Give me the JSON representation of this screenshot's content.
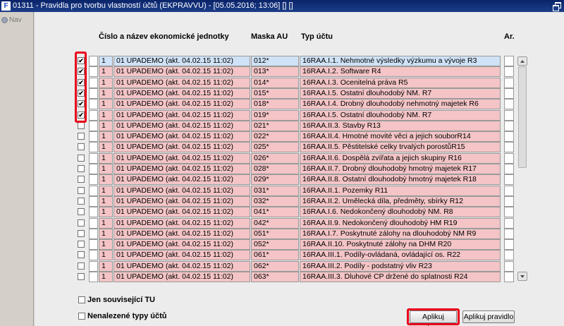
{
  "window": {
    "title": "01311 - Pravidla pro tvorbu vlastností účtů (EKPRAVVU) - [05.05.2016; 13:06] [] []",
    "app_icon": "F"
  },
  "nav": {
    "label": "Nav"
  },
  "columns": {
    "unit": "Číslo a název ekonomické jednotky",
    "mask": "Maska AU",
    "type": "Typ účtu",
    "ar": "Ar."
  },
  "rows": [
    {
      "checked": true,
      "num": "1",
      "unit": "01 UPADEMO (akt. 04.02.15 11:02)",
      "mask": "012*",
      "type": "16RAA.I.1.  Nehmotné výsledky výzkumu a vývoje R3",
      "highlight": "blue"
    },
    {
      "checked": true,
      "num": "1",
      "unit": "01 UPADEMO (akt. 04.02.15 11:02)",
      "mask": "013*",
      "type": "16RAA.I.2.  Software R4",
      "highlight": "pink"
    },
    {
      "checked": true,
      "num": "1",
      "unit": "01 UPADEMO (akt. 04.02.15 11:02)",
      "mask": "014*",
      "type": "16RAA.I.3.  Ocenitelná práva R5",
      "highlight": "pink"
    },
    {
      "checked": true,
      "num": "1",
      "unit": "01 UPADEMO (akt. 04.02.15 11:02)",
      "mask": "015*",
      "type": "16RAA.I.5.  Ostatní dlouhodobý NM. R7",
      "highlight": "pink"
    },
    {
      "checked": true,
      "num": "1",
      "unit": "01 UPADEMO (akt. 04.02.15 11:02)",
      "mask": "018*",
      "type": "16RAA.I.4.  Drobný dlouhodobý nehmotný majetek R6",
      "highlight": "pink"
    },
    {
      "checked": true,
      "num": "1",
      "unit": "01 UPADEMO (akt. 04.02.15 11:02)",
      "mask": "019*",
      "type": "16RAA.I.5.  Ostatní dlouhodobý NM. R7",
      "highlight": "pink"
    },
    {
      "checked": false,
      "num": "1",
      "unit": "01 UPADEMO (akt. 04.02.15 11:02)",
      "mask": "021*",
      "type": "16RAA.II.3.  Stavby R13",
      "highlight": "pink"
    },
    {
      "checked": false,
      "num": "1",
      "unit": "01 UPADEMO (akt. 04.02.15 11:02)",
      "mask": "022*",
      "type": "16RAA.II.4.  Hmotné movité věci a jejich souborR14",
      "highlight": "pink"
    },
    {
      "checked": false,
      "num": "1",
      "unit": "01 UPADEMO (akt. 04.02.15 11:02)",
      "mask": "025*",
      "type": "16RAA.II.5.  Pěstitelské celky trvalých porostůR15",
      "highlight": "pink"
    },
    {
      "checked": false,
      "num": "1",
      "unit": "01 UPADEMO (akt. 04.02.15 11:02)",
      "mask": "026*",
      "type": "16RAA.II.6.  Dospělá zvířata a jejich skupiny R16",
      "highlight": "pink"
    },
    {
      "checked": false,
      "num": "1",
      "unit": "01 UPADEMO (akt. 04.02.15 11:02)",
      "mask": "028*",
      "type": "16RAA.II.7.  Drobný dlouhodobý hmotný majetek R17",
      "highlight": "pink"
    },
    {
      "checked": false,
      "num": "1",
      "unit": "01 UPADEMO (akt. 04.02.15 11:02)",
      "mask": "029*",
      "type": "16RAA.II.8.  Ostatní dlouhodobý hmotný majetek R18",
      "highlight": "pink"
    },
    {
      "checked": false,
      "num": "1",
      "unit": "01 UPADEMO (akt. 04.02.15 11:02)",
      "mask": "031*",
      "type": "16RAA.II.1.  Pozemky R11",
      "highlight": "pink"
    },
    {
      "checked": false,
      "num": "1",
      "unit": "01 UPADEMO (akt. 04.02.15 11:02)",
      "mask": "032*",
      "type": "16RAA.II.2.  Umělecká díla, předměty, sbírky R12",
      "highlight": "pink"
    },
    {
      "checked": false,
      "num": "1",
      "unit": "01 UPADEMO (akt. 04.02.15 11:02)",
      "mask": "041*",
      "type": "16RAA.I.6.  Nedokončený dlouhodobý NM. R8",
      "highlight": "pink"
    },
    {
      "checked": false,
      "num": "1",
      "unit": "01 UPADEMO (akt. 04.02.15 11:02)",
      "mask": "042*",
      "type": "16RAA.II.9.  Nedokončený dlouhodobý HM R19",
      "highlight": "pink"
    },
    {
      "checked": false,
      "num": "1",
      "unit": "01 UPADEMO (akt. 04.02.15 11:02)",
      "mask": "051*",
      "type": "16RAA.I.7.  Poskytnuté zálohy na dlouhodobý NM R9",
      "highlight": "pink"
    },
    {
      "checked": false,
      "num": "1",
      "unit": "01 UPADEMO (akt. 04.02.15 11:02)",
      "mask": "052*",
      "type": "16RAA.II.10.  Poskytnuté zálohy na DHM R20",
      "highlight": "pink"
    },
    {
      "checked": false,
      "num": "1",
      "unit": "01 UPADEMO (akt. 04.02.15 11:02)",
      "mask": "061*",
      "type": "16RAA.III.1.  Podíly-ovládaná, ovládající os. R22",
      "highlight": "pink"
    },
    {
      "checked": false,
      "num": "1",
      "unit": "01 UPADEMO (akt. 04.02.15 11:02)",
      "mask": "062*",
      "type": "16RAA.III.2.  Podíly - podstatný vliv R23",
      "highlight": "pink"
    },
    {
      "checked": false,
      "num": "1",
      "unit": "01 UPADEMO (akt. 04.02.15 11:02)",
      "mask": "063*",
      "type": "16RAA.III.3.  Dluhové CP držené do splatnosti R24",
      "highlight": "pink"
    }
  ],
  "options": {
    "related_tu": "Jen související TU",
    "not_found_types": "Nenalezené  typy účtů"
  },
  "buttons": {
    "apply_selected": "Aplikuj vybrana",
    "apply_rule": "Aplikuj pravidlo"
  },
  "colors": {
    "highlight_red": "#e8001b",
    "row_pink": "#f4c4c6",
    "row_blue": "#cfe2f6",
    "titlebar": "#0a246a"
  }
}
